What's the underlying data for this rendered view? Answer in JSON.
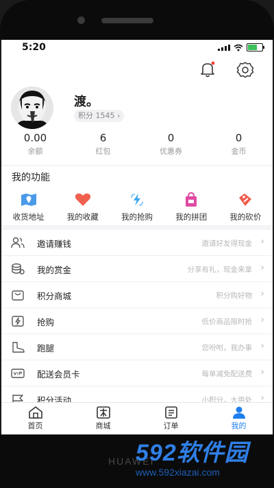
{
  "status": {
    "time": "5:20"
  },
  "profile": {
    "nickname": "渡。",
    "points_label": "积分 1545 ›"
  },
  "stats": [
    {
      "value": "0.00",
      "label": "余额"
    },
    {
      "value": "6",
      "label": "红包"
    },
    {
      "value": "0",
      "label": "优惠券"
    },
    {
      "value": "0",
      "label": "金币"
    }
  ],
  "functions": {
    "title": "我的功能",
    "items": [
      {
        "label": "收货地址",
        "icon": "map-icon",
        "color": "#4a9ae8"
      },
      {
        "label": "我的收藏",
        "icon": "heart-icon",
        "color": "#f0604e"
      },
      {
        "label": "我的抢购",
        "icon": "flash-icon",
        "color": "#3aa6f0"
      },
      {
        "label": "我的拼团",
        "icon": "group-bag-icon",
        "color": "#e04aa2"
      },
      {
        "label": "我的砍价",
        "icon": "bargain-tag-icon",
        "color": "#ef5a4a"
      }
    ]
  },
  "menu": [
    {
      "label": "邀请赚钱",
      "hint": "邀请好友得现金",
      "icon": "users-icon"
    },
    {
      "label": "我的赏金",
      "hint": "分享有礼，现金来拿",
      "icon": "coins-icon"
    },
    {
      "label": "积分商城",
      "hint": "积分购好物",
      "icon": "mall-bag-icon"
    },
    {
      "label": "抢购",
      "hint": "低价商品限时抢",
      "icon": "flash-box-icon"
    },
    {
      "label": "跑腿",
      "hint": "您吩咐，我办事",
      "icon": "boot-icon"
    },
    {
      "label": "配送会员卡",
      "hint": "每单减免配送费",
      "icon": "vip-card-icon"
    },
    {
      "label": "积分活动",
      "hint": "小积分，大用处",
      "icon": "flag-icon"
    }
  ],
  "tabs": [
    {
      "label": "首页",
      "icon": "home-icon"
    },
    {
      "label": "商城",
      "icon": "mall-icon"
    },
    {
      "label": "订单",
      "icon": "order-icon"
    },
    {
      "label": "我的",
      "icon": "profile-icon",
      "active": true
    }
  ],
  "device": {
    "brand": "HUAWEI"
  },
  "watermark": {
    "title_num": "592",
    "title_cn": "软件园",
    "url": "www.592xiazai.com"
  },
  "colors": {
    "accent": "#1e7ef0",
    "notify_dot": "#f2403a"
  }
}
